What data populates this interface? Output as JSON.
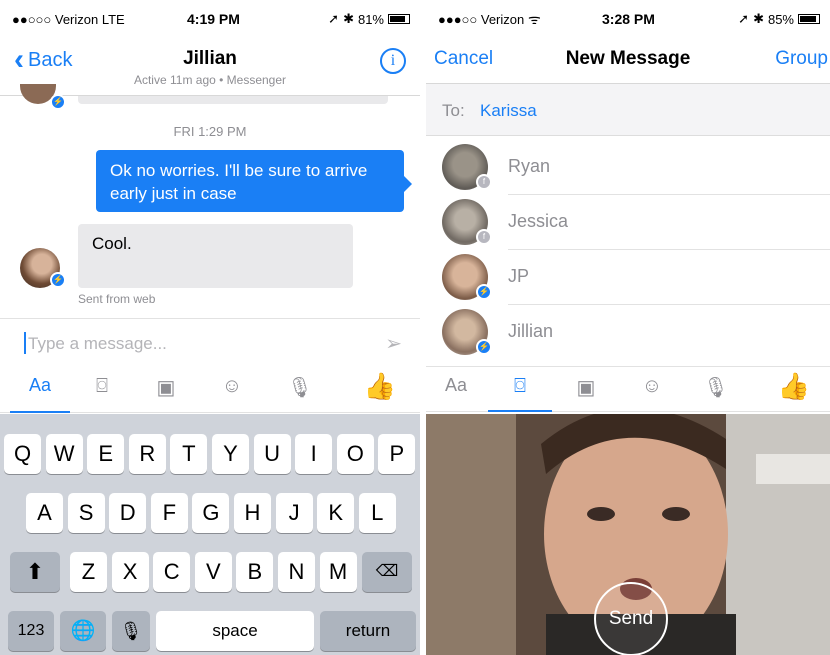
{
  "left": {
    "status": {
      "carrier": "●●○○○ Verizon  LTE",
      "time": "4:19 PM",
      "battery": "81%"
    },
    "nav": {
      "back": "Back",
      "title": "Jillian",
      "subtitle": "Active 11m ago • Messenger"
    },
    "timestamp": "FRI 1:29 PM",
    "outgoing": "Ok no worries. I'll be sure to arrive early just in case",
    "incoming": "Cool.",
    "sent_from": "Sent from web",
    "composer": {
      "placeholder": "Type a message..."
    },
    "tools": {
      "text": "Aa"
    },
    "keyboard": {
      "row1": [
        "Q",
        "W",
        "E",
        "R",
        "T",
        "Y",
        "U",
        "I",
        "O",
        "P"
      ],
      "row2": [
        "A",
        "S",
        "D",
        "F",
        "G",
        "H",
        "J",
        "K",
        "L"
      ],
      "row3": [
        "Z",
        "X",
        "C",
        "V",
        "B",
        "N",
        "M"
      ],
      "numbers": "123",
      "space": "space",
      "return": "return"
    }
  },
  "right": {
    "status": {
      "carrier": "●●●○○ Verizon",
      "time": "3:28 PM",
      "battery": "85%"
    },
    "nav": {
      "cancel": "Cancel",
      "title": "New Message",
      "group": "Group"
    },
    "to": {
      "label": "To:",
      "value": "Karissa"
    },
    "contacts": [
      {
        "name": "Ryan"
      },
      {
        "name": "Jessica"
      },
      {
        "name": "JP"
      },
      {
        "name": "Jillian"
      }
    ],
    "tools": {
      "text": "Aa"
    },
    "camera": {
      "send": "Send"
    }
  },
  "colors": {
    "accent": "#1a7ff5",
    "bubble_in": "#e9e9eb",
    "keyboard_bg": "#cfd3da"
  }
}
